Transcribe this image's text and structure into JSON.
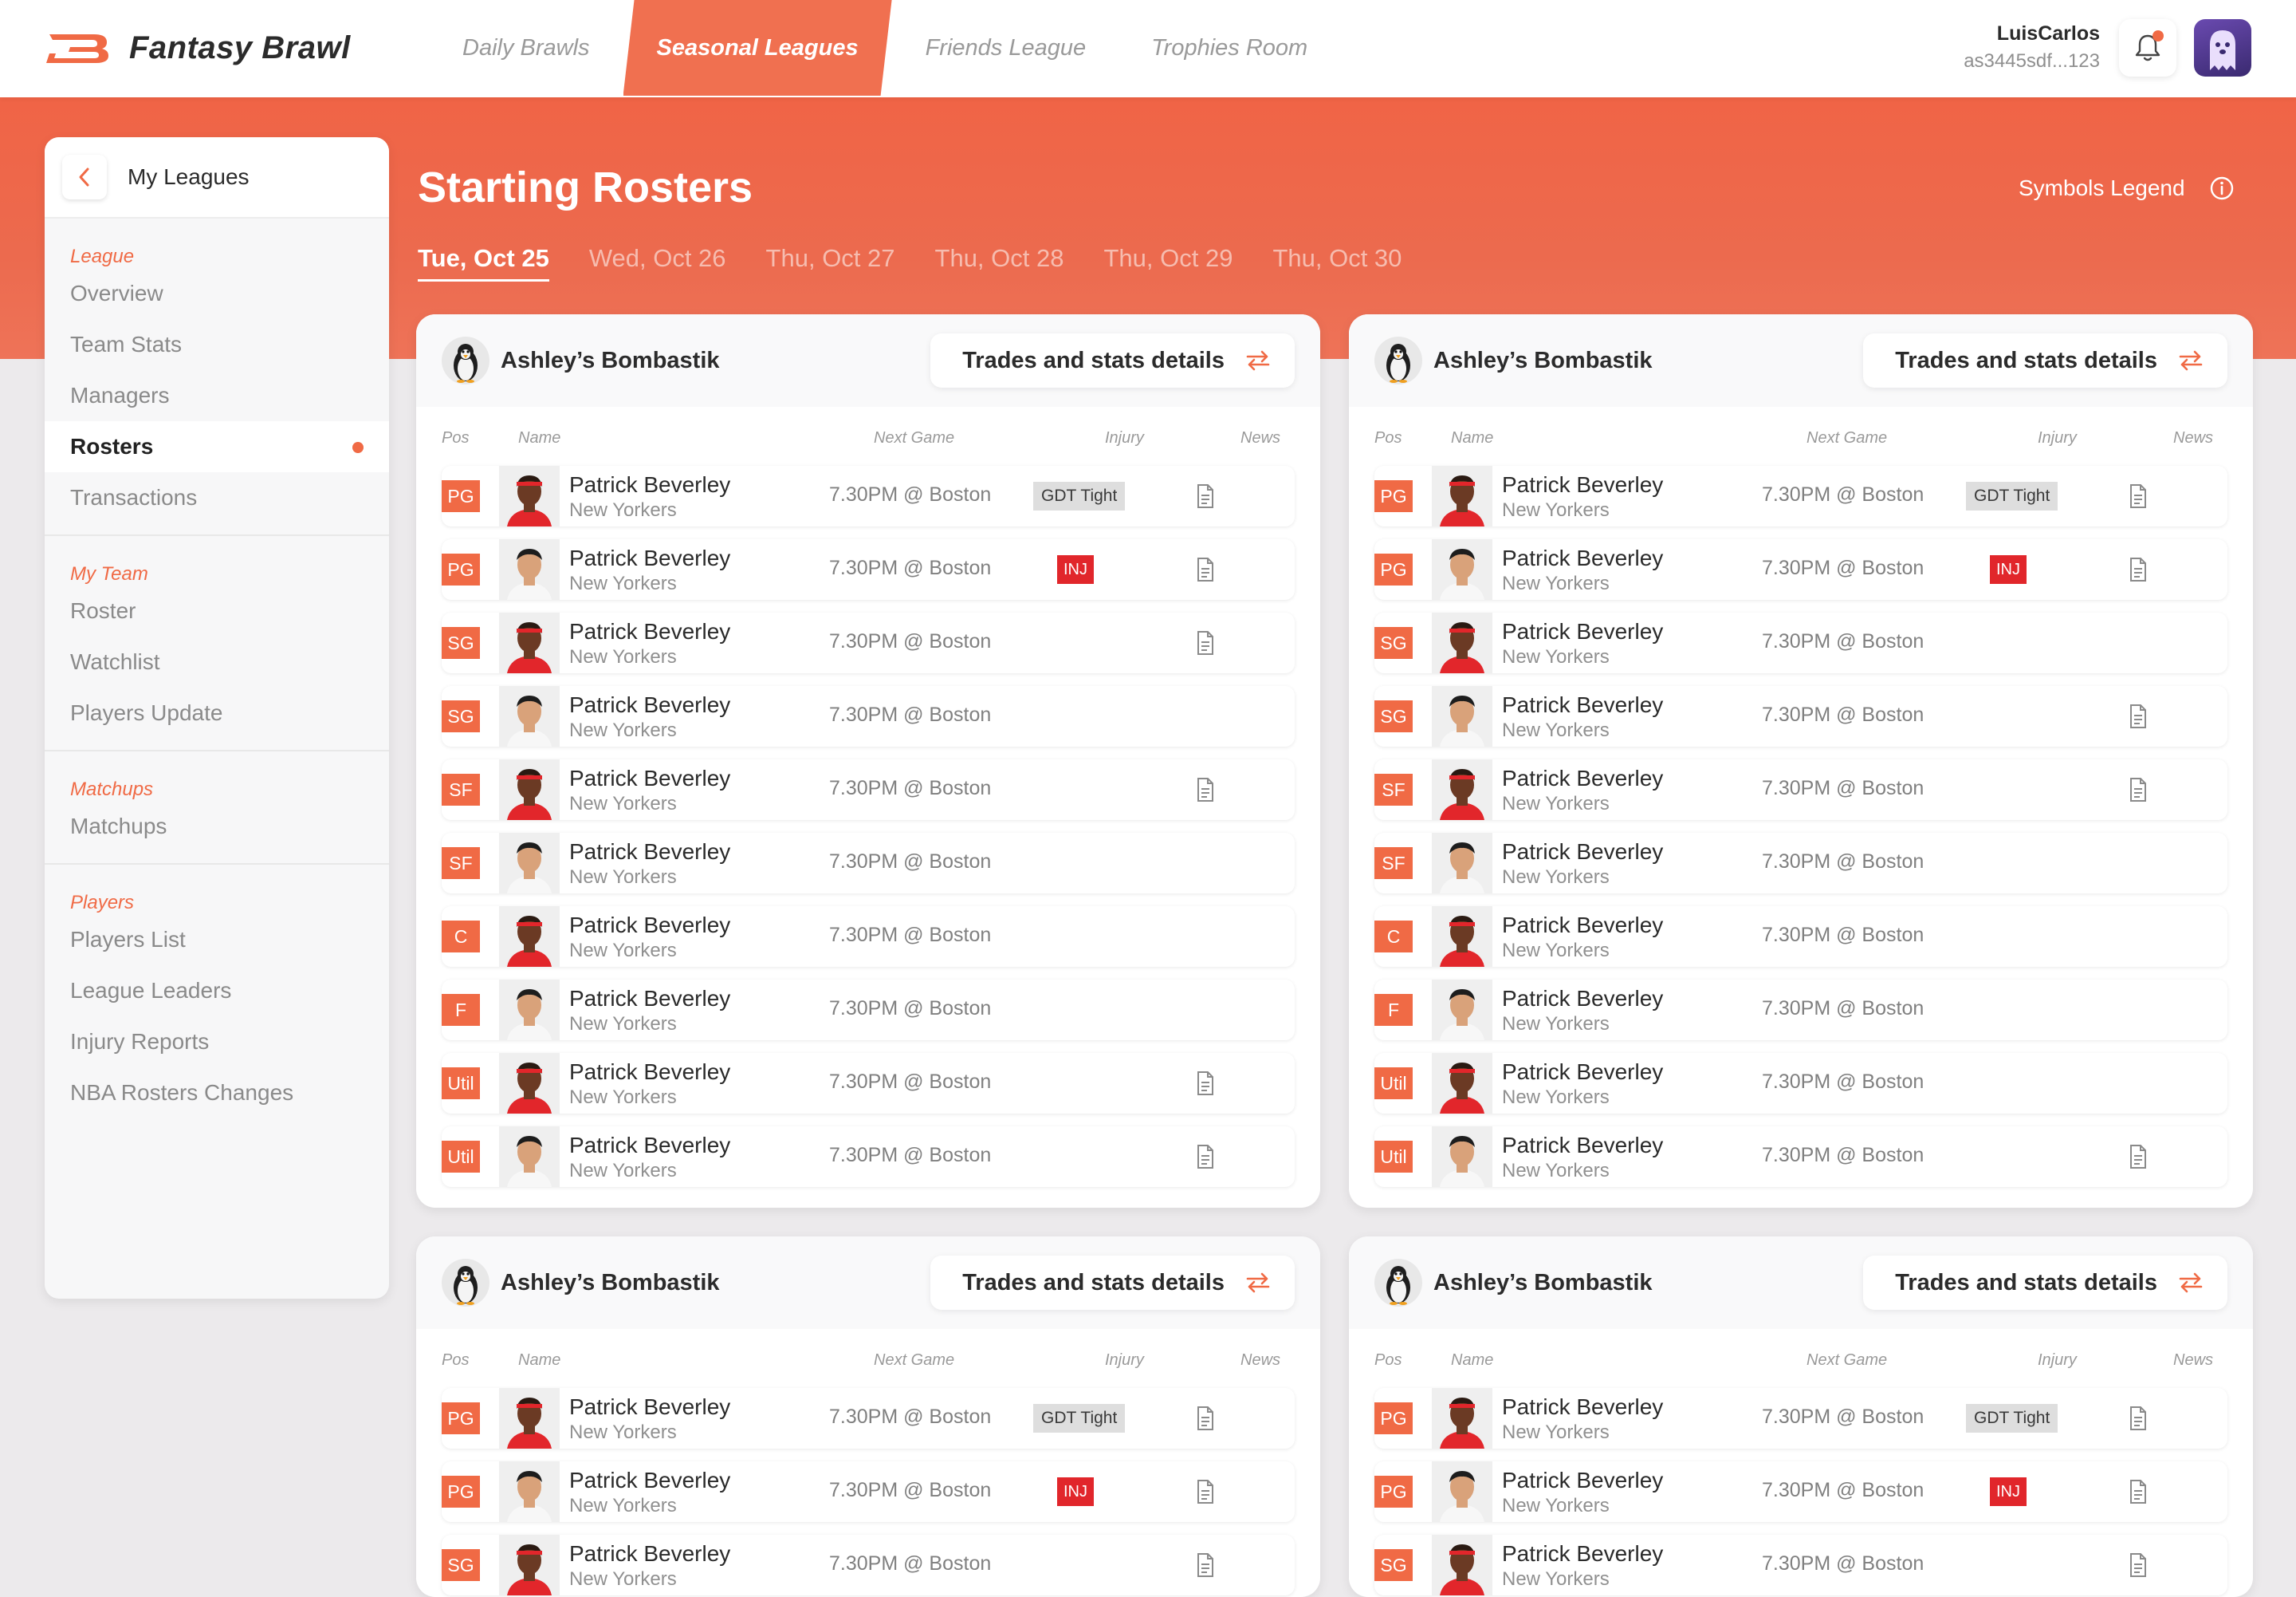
{
  "app": {
    "brand": "Fantasy Brawl",
    "nav": [
      "Daily Brawls",
      "Seasonal Leagues",
      "Friends League",
      "Trophies Room"
    ],
    "active_nav": 1,
    "user": {
      "name": "LuisCarlos",
      "id": "as3445sdf...123"
    },
    "colors": {
      "accent": "#f06a45",
      "injury": "#e1262b"
    }
  },
  "sidebar": {
    "title": "My Leagues",
    "sections": [
      {
        "label": "League",
        "items": [
          "Overview",
          "Team Stats",
          "Managers",
          "Rosters",
          "Transactions"
        ]
      },
      {
        "label": "My Team",
        "items": [
          "Roster",
          "Watchlist",
          "Players Update"
        ]
      },
      {
        "label": "Matchups",
        "items": [
          "Matchups"
        ]
      },
      {
        "label": "Players",
        "items": [
          "Players List",
          "League Leaders",
          "Injury Reports",
          "NBA Rosters Changes"
        ]
      }
    ],
    "active_item": "Rosters"
  },
  "main": {
    "title": "Starting Rosters",
    "legend": "Symbols Legend",
    "dates": [
      "Tue, Oct 25",
      "Wed, Oct 26",
      "Thu, Oct 27",
      "Thu, Oct 28",
      "Thu, Oct 29",
      "Thu, Oct 30"
    ],
    "active_date": 0,
    "columns": {
      "pos": "Pos",
      "name": "Name",
      "next_game": "Next Game",
      "injury": "Injury",
      "news": "News"
    },
    "cards": [
      {
        "team": "Ashley’s Bombastik",
        "button": "Trades and stats details",
        "players": [
          {
            "pos": "PG",
            "name": "Patrick Beverley",
            "team": "New Yorkers",
            "game": "7.30PM @ Boston",
            "injury": "GDT Tight",
            "news": true
          },
          {
            "pos": "PG",
            "name": "Patrick Beverley",
            "team": "New Yorkers",
            "game": "7.30PM @ Boston",
            "injury": "INJ",
            "news": true
          },
          {
            "pos": "SG",
            "name": "Patrick Beverley",
            "team": "New Yorkers",
            "game": "7.30PM @ Boston",
            "injury": "",
            "news": true
          },
          {
            "pos": "SG",
            "name": "Patrick Beverley",
            "team": "New Yorkers",
            "game": "7.30PM @ Boston",
            "injury": "",
            "news": false
          },
          {
            "pos": "SF",
            "name": "Patrick Beverley",
            "team": "New Yorkers",
            "game": "7.30PM @ Boston",
            "injury": "",
            "news": true
          },
          {
            "pos": "SF",
            "name": "Patrick Beverley",
            "team": "New Yorkers",
            "game": "7.30PM @ Boston",
            "injury": "",
            "news": false
          },
          {
            "pos": "C",
            "name": "Patrick Beverley",
            "team": "New Yorkers",
            "game": "7.30PM @ Boston",
            "injury": "",
            "news": false
          },
          {
            "pos": "F",
            "name": "Patrick Beverley",
            "team": "New Yorkers",
            "game": "7.30PM @ Boston",
            "injury": "",
            "news": false
          },
          {
            "pos": "Util",
            "name": "Patrick Beverley",
            "team": "New Yorkers",
            "game": "7.30PM @ Boston",
            "injury": "",
            "news": true
          },
          {
            "pos": "Util",
            "name": "Patrick Beverley",
            "team": "New Yorkers",
            "game": "7.30PM @ Boston",
            "injury": "",
            "news": true
          }
        ]
      },
      {
        "team": "Ashley’s Bombastik",
        "button": "Trades and stats details",
        "players": [
          {
            "pos": "PG",
            "name": "Patrick Beverley",
            "team": "New Yorkers",
            "game": "7.30PM @ Boston",
            "injury": "GDT Tight",
            "news": true
          },
          {
            "pos": "PG",
            "name": "Patrick Beverley",
            "team": "New Yorkers",
            "game": "7.30PM @ Boston",
            "injury": "INJ",
            "news": true
          },
          {
            "pos": "SG",
            "name": "Patrick Beverley",
            "team": "New Yorkers",
            "game": "7.30PM @ Boston",
            "injury": "",
            "news": false
          },
          {
            "pos": "SG",
            "name": "Patrick Beverley",
            "team": "New Yorkers",
            "game": "7.30PM @ Boston",
            "injury": "",
            "news": true
          },
          {
            "pos": "SF",
            "name": "Patrick Beverley",
            "team": "New Yorkers",
            "game": "7.30PM @ Boston",
            "injury": "",
            "news": true
          },
          {
            "pos": "SF",
            "name": "Patrick Beverley",
            "team": "New Yorkers",
            "game": "7.30PM @ Boston",
            "injury": "",
            "news": false
          },
          {
            "pos": "C",
            "name": "Patrick Beverley",
            "team": "New Yorkers",
            "game": "7.30PM @ Boston",
            "injury": "",
            "news": false
          },
          {
            "pos": "F",
            "name": "Patrick Beverley",
            "team": "New Yorkers",
            "game": "7.30PM @ Boston",
            "injury": "",
            "news": false
          },
          {
            "pos": "Util",
            "name": "Patrick Beverley",
            "team": "New Yorkers",
            "game": "7.30PM @ Boston",
            "injury": "",
            "news": false
          },
          {
            "pos": "Util",
            "name": "Patrick Beverley",
            "team": "New Yorkers",
            "game": "7.30PM @ Boston",
            "injury": "",
            "news": true
          }
        ]
      },
      {
        "team": "Ashley’s Bombastik",
        "button": "Trades and stats details",
        "players": [
          {
            "pos": "PG",
            "name": "Patrick Beverley",
            "team": "New Yorkers",
            "game": "7.30PM @ Boston",
            "injury": "GDT Tight",
            "news": true
          },
          {
            "pos": "PG",
            "name": "Patrick Beverley",
            "team": "New Yorkers",
            "game": "7.30PM @ Boston",
            "injury": "INJ",
            "news": true
          },
          {
            "pos": "SG",
            "name": "Patrick Beverley",
            "team": "New Yorkers",
            "game": "7.30PM @ Boston",
            "injury": "",
            "news": true
          }
        ]
      },
      {
        "team": "Ashley’s Bombastik",
        "button": "Trades and stats details",
        "players": [
          {
            "pos": "PG",
            "name": "Patrick Beverley",
            "team": "New Yorkers",
            "game": "7.30PM @ Boston",
            "injury": "GDT Tight",
            "news": true
          },
          {
            "pos": "PG",
            "name": "Patrick Beverley",
            "team": "New Yorkers",
            "game": "7.30PM @ Boston",
            "injury": "INJ",
            "news": true
          },
          {
            "pos": "SG",
            "name": "Patrick Beverley",
            "team": "New Yorkers",
            "game": "7.30PM @ Boston",
            "injury": "",
            "news": true
          }
        ]
      }
    ]
  }
}
